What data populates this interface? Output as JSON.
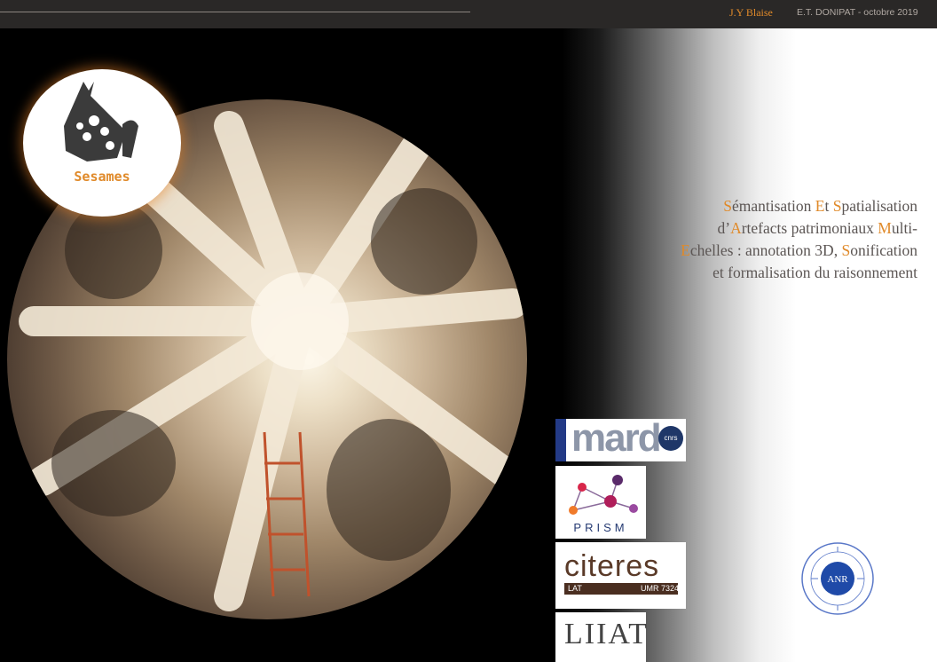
{
  "header": {
    "author": "J.Y Blaise",
    "event": "E.T. DONIPAT - octobre 2019"
  },
  "logo": {
    "label": "Sesames",
    "accent_color": "#e08a2a"
  },
  "title": {
    "segments": [
      {
        "cap": "S",
        "rest": "émantisation "
      },
      {
        "cap": "E",
        "rest": "t "
      },
      {
        "cap": "S",
        "rest": "patialisation"
      },
      {
        "br": true
      },
      {
        "cap": "",
        "rest": "d’"
      },
      {
        "cap": "A",
        "rest": "rtefacts patrimoniaux "
      },
      {
        "cap": "M",
        "rest": "ulti-"
      },
      {
        "br": true
      },
      {
        "cap": "E",
        "rest": "chelles : annotation 3D, "
      },
      {
        "cap": "S",
        "rest": "onification"
      },
      {
        "br": true
      },
      {
        "cap": "",
        "rest": "et formalisation du raisonnement"
      }
    ]
  },
  "partners": {
    "mard": "mard",
    "cnrs": "cnrs",
    "prism": "PRISM",
    "citeres": "citeres",
    "citeres_lat": "LAT",
    "citeres_umr": "UMR 7324",
    "liiat": "LIIAT"
  },
  "anr": {
    "logo": "ANR"
  },
  "colors": {
    "accent": "#e08a2a",
    "title_text": "#5c5654",
    "topbar": "#2a2827"
  }
}
